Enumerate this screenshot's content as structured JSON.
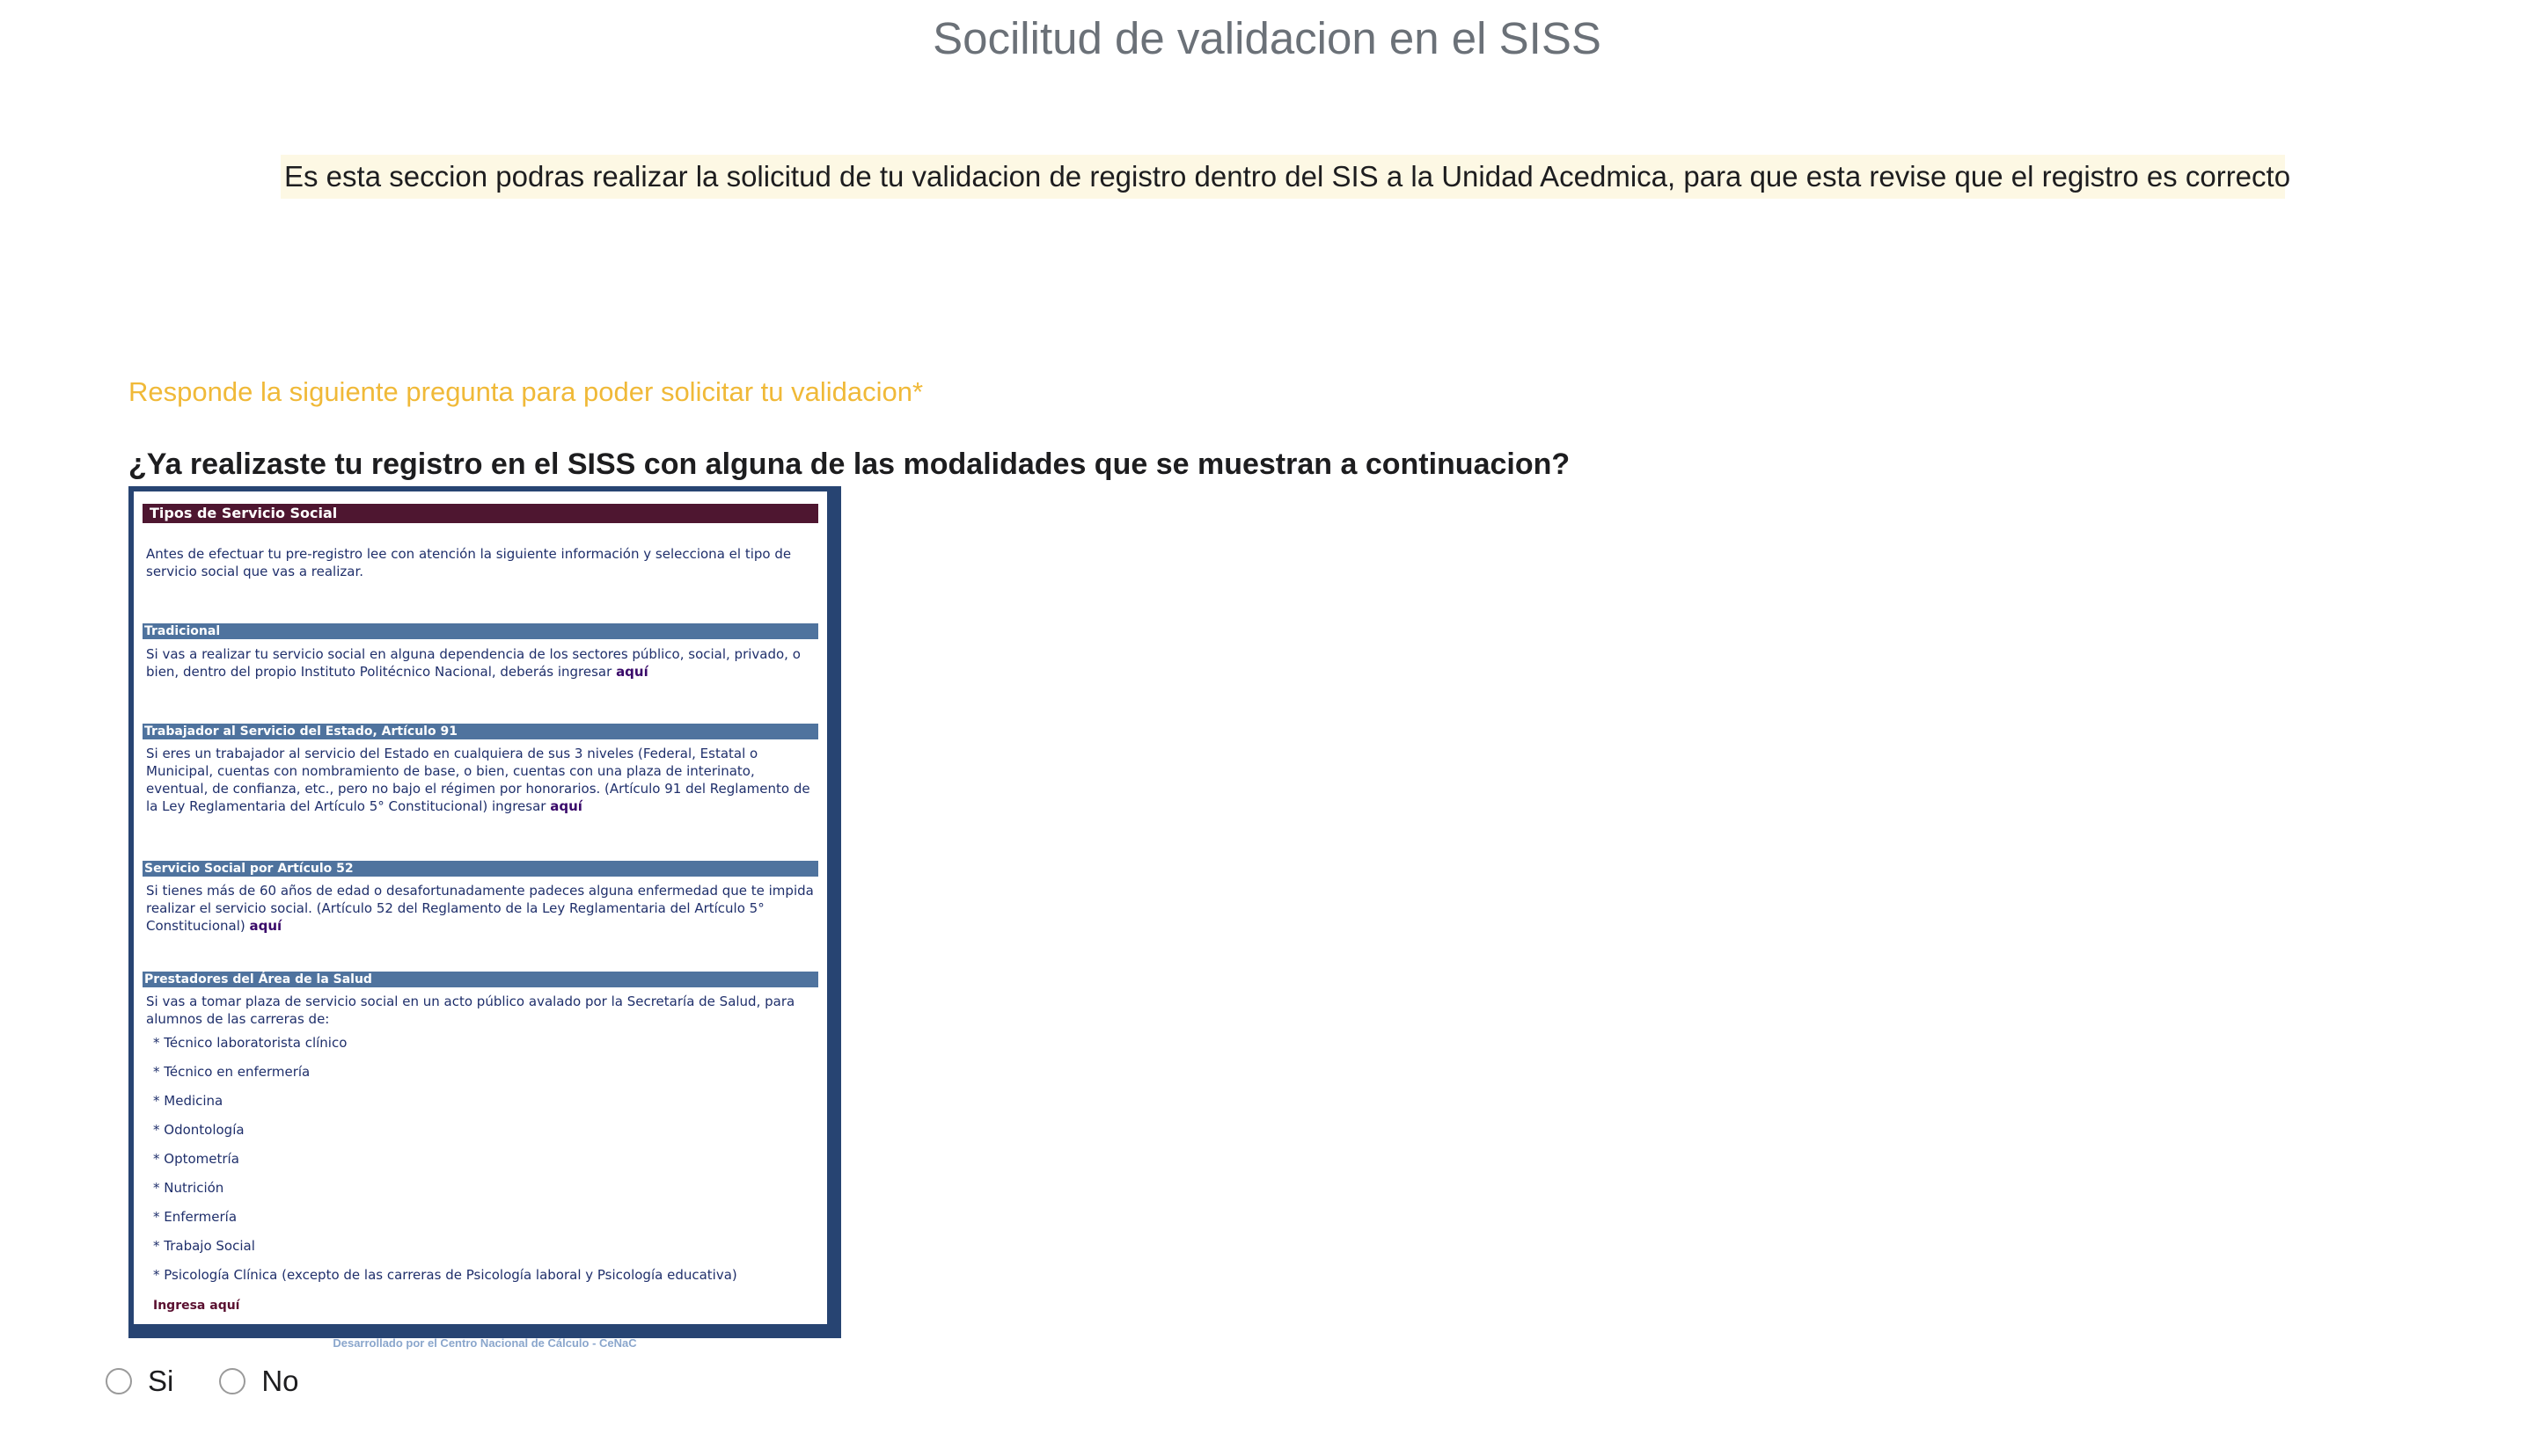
{
  "page_title": "Socilitud de validacion en el SISS",
  "notice": "Es esta seccion podras realizar la solicitud de tu validacion de registro dentro del SIS a la Unidad Acedmica, para que esta revise que el registro es correcto",
  "prompt": "Responde la siguiente pregunta para poder solicitar tu validacion*",
  "question": "¿Ya realizaste tu registro en el SISS con alguna de las modalidades que se muestran a continuacion?",
  "document": {
    "header": "Tipos de Servicio Social",
    "intro": "Antes de efectuar tu pre-registro lee con atención la siguiente información y selecciona el tipo de servicio social que vas a realizar.",
    "sections": [
      {
        "title": "Tradicional",
        "text": "Si vas a realizar tu servicio social en alguna dependencia de los sectores público, social, privado, o bien, dentro del propio Instituto Politécnico Nacional, deberás ingresar",
        "link": "aquí"
      },
      {
        "title": "Trabajador al Servicio del Estado, Artículo 91",
        "text": "Si eres un trabajador al servicio del Estado en cualquiera de sus 3 niveles (Federal, Estatal o Municipal, cuentas con nombramiento de base, o bien, cuentas con una plaza de interinato, eventual, de confianza, etc., pero no bajo el régimen por honorarios. (Artículo 91 del Reglamento de la Ley Reglamentaria del Artículo 5° Constitucional) ingresar",
        "link": "aquí"
      },
      {
        "title": "Servicio Social por Artículo 52",
        "text": "Si tienes más de 60 años de edad o desafortunadamente padeces alguna enfermedad que te impida realizar el servicio social. (Artículo 52 del Reglamento de la Ley Reglamentaria del Artículo 5° Constitucional)",
        "link": "aquí"
      },
      {
        "title": "Prestadores del Área de la Salud",
        "text": "Si vas a tomar plaza de servicio social en un acto público avalado por la Secretaría de Salud, para alumnos de las carreras de:",
        "link": ""
      }
    ],
    "careers": [
      "* Técnico laboratorista clínico",
      "* Técnico en enfermería",
      "* Medicina",
      "* Odontología",
      "* Optometría",
      "* Nutrición",
      "* Enfermería",
      "* Trabajo Social",
      "* Psicología Clínica (excepto de las carreras de Psicología laboral y Psicología educativa)"
    ],
    "ingresa": "Ingresa aquí",
    "footer": "Desarrollado por el Centro Nacional de Cálculo - CeNaC"
  },
  "options": [
    {
      "label": "Si"
    },
    {
      "label": "No"
    }
  ],
  "colors": {
    "prompt": "#f0b938",
    "notice_bg": "#fdf8e4",
    "doc_frame": "#274472",
    "doc_header": "#4e1630",
    "doc_section": "#4f739e"
  }
}
